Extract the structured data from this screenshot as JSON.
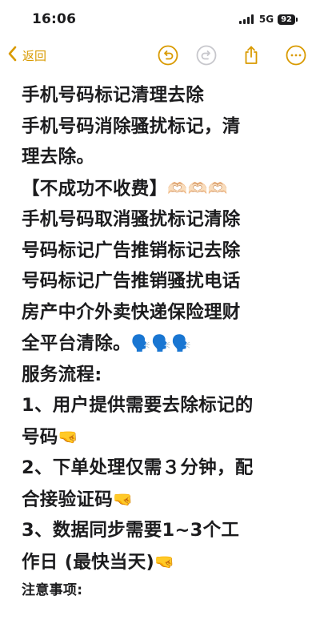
{
  "status_bar": {
    "time": "16:06",
    "network": "5G",
    "battery": "92"
  },
  "nav": {
    "back_label": "返回"
  },
  "note": {
    "lines": [
      "手机号码标记清理去除",
      "手机号码消除骚扰标记，清",
      "理去除。",
      "【不成功不收费】",
      "手机号码取消骚扰标记清除",
      "号码标记广告推销标记去除",
      "号码标记广告推销骚扰电话",
      "房产中介外卖快递保险理财",
      "全平台清除。",
      "服务流程:",
      "1、用户提供需要去除标记的",
      "号码",
      "2、下单处理仅需３分钟，配",
      "合接验证码",
      "3、数据同步需要1~3个工",
      "作日 (最快当天)",
      "注意事项:"
    ],
    "emojis": {
      "hands": "🫶🏻🫶🏻🫶🏻",
      "speaking": "🗣️🗣️🗣️",
      "pointing": "🤜"
    }
  },
  "colors": {
    "accent": "#d99a00",
    "text": "#1c1c1e",
    "background": "#ffffff"
  },
  "icons": [
    "chevron-left-icon",
    "undo-icon",
    "redo-icon",
    "share-icon",
    "more-icon",
    "signal-icon",
    "battery-icon"
  ]
}
